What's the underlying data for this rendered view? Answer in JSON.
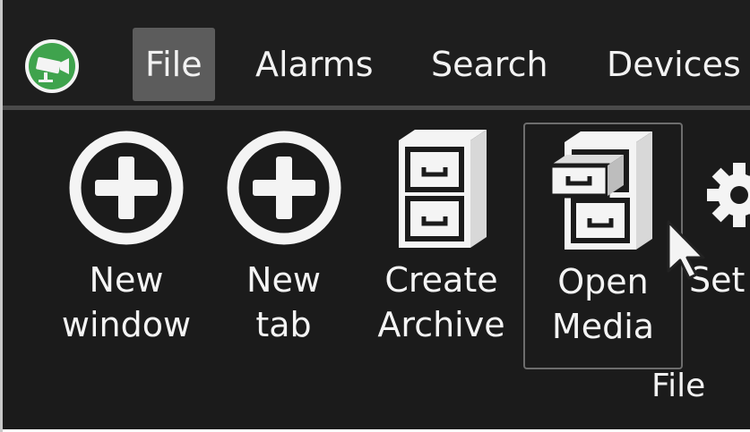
{
  "menu": {
    "items": [
      {
        "label": "File",
        "active": true
      },
      {
        "label": "Alarms",
        "active": false
      },
      {
        "label": "Search",
        "active": false
      },
      {
        "label": "Devices",
        "active": false
      }
    ]
  },
  "ribbon": {
    "buttons": [
      {
        "line1": "New",
        "line2": "window",
        "icon": "plus-circle-icon"
      },
      {
        "line1": "New",
        "line2": "tab",
        "icon": "plus-circle-icon"
      },
      {
        "line1": "Create",
        "line2": "Archive",
        "icon": "file-cabinet-icon"
      },
      {
        "line1": "Open",
        "line2": "Media",
        "icon": "open-file-cabinet-icon"
      },
      {
        "line1": "Set",
        "line2": "",
        "icon": "gear-icon"
      }
    ],
    "group_label": "File"
  },
  "colors": {
    "background": "#1c1c1c",
    "active_menu": "#5c5c5c",
    "logo_green": "#3fa34d",
    "text": "#f2f2f2"
  }
}
